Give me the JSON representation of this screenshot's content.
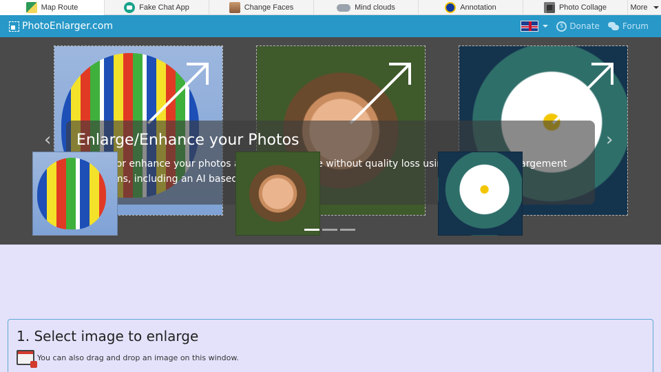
{
  "topbar": {
    "items": [
      {
        "label": "Map Route",
        "icon": "map-route-icon",
        "active": true
      },
      {
        "label": "Fake Chat App",
        "icon": "chat-app-icon"
      },
      {
        "label": "Change Faces",
        "icon": "change-faces-icon"
      },
      {
        "label": "Mind clouds",
        "icon": "mind-clouds-icon"
      },
      {
        "label": "Annotation",
        "icon": "annotation-icon"
      },
      {
        "label": "Photo Collage",
        "icon": "photo-collage-icon"
      },
      {
        "label": "More",
        "icon": "caret-down-icon"
      }
    ]
  },
  "site": {
    "brand": "PhotoEnlarger.com",
    "donate": "Donate",
    "forum": "Forum",
    "language_icon": "uk-flag-icon"
  },
  "carousel": {
    "title": "Enlarge/Enhance your Photos",
    "description": "Enlarge or enhance your photos and images online without quality loss using 6 different enlargement algorithms, including an AI based one (esrgan).",
    "prev": "‹",
    "next": "›",
    "active_slide": 1,
    "slide_count": 3
  },
  "section": {
    "title": "1. Select image to enlarge",
    "drop_hint": "You can also drag and drop an image on this window."
  }
}
